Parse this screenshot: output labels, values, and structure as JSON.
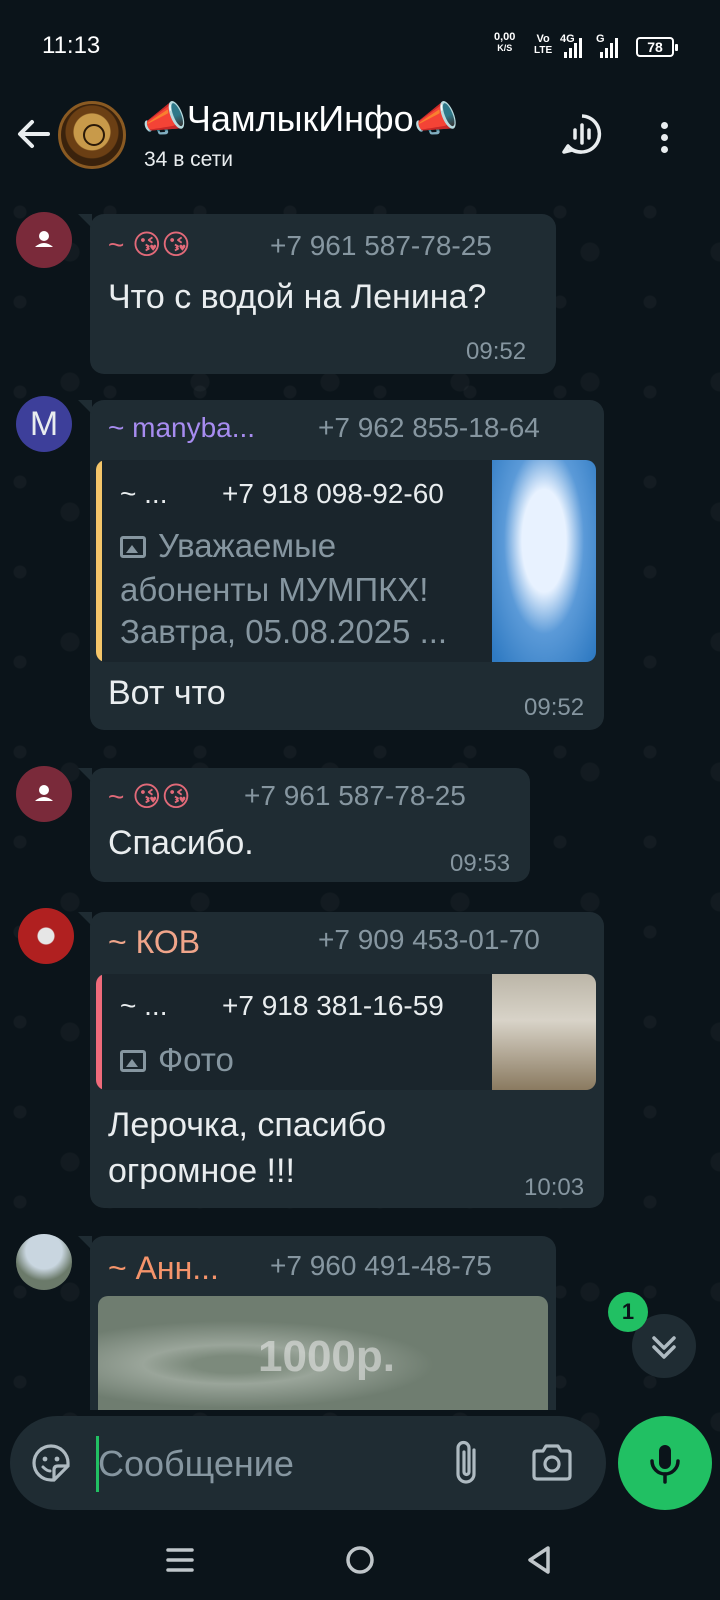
{
  "status": {
    "time": "11:13",
    "net_speed": "0,00",
    "net_unit": "K/S",
    "volte_top": "Vo",
    "volte_bottom": "LTE",
    "sig1_label": "4G",
    "sig2_label": "G",
    "battery": "78"
  },
  "header": {
    "title": "📣ЧамлыкИнфо📣",
    "subtitle": "34 в сети"
  },
  "messages": [
    {
      "sender": "~ 😘😘",
      "phone": "+7 961 587-78-25",
      "text": "Что с водой на Ленина?",
      "time": "09:52",
      "sender_color": "#e26a79"
    },
    {
      "avatar_letter": "M",
      "sender": "~ manyba...",
      "phone": "+7 962 855-18-64",
      "quote_sender": "~ ...",
      "quote_phone": "+7 918 098-92-60",
      "quote_line1": "Уважаемые",
      "quote_line2": "абоненты МУМПКХ!",
      "quote_line3": "Завтра, 05.08.2025 ...",
      "text": "Вот что",
      "time": "09:52",
      "sender_color": "#a78cf0",
      "quote_bar_color": "#f5c66a"
    },
    {
      "sender": "~ 😘😘",
      "phone": "+7 961 587-78-25",
      "text": "Спасибо.",
      "time": "09:53",
      "sender_color": "#e26a79"
    },
    {
      "sender": "~ КОВ",
      "phone": "+7 909 453-01-70",
      "quote_sender": "~ ...",
      "quote_phone": "+7 918 381-16-59",
      "quote_line1": "Фото",
      "text_line1": "Лерочка, спасибо",
      "text_line2": "огромное !!!",
      "time": "10:03",
      "sender_color": "#f0a58a",
      "quote_bar_color": "#ef6b7b"
    },
    {
      "sender": "~ Анн...",
      "phone": "+7 960 491-48-75",
      "image_caption": "1000р.",
      "sender_color": "#f5946b"
    }
  ],
  "scroll": {
    "unread": "1"
  },
  "composer": {
    "placeholder": "Сообщение"
  },
  "colors": {
    "accent": "#21c063",
    "bubble": "#1f2c33",
    "background": "#0b141a"
  }
}
